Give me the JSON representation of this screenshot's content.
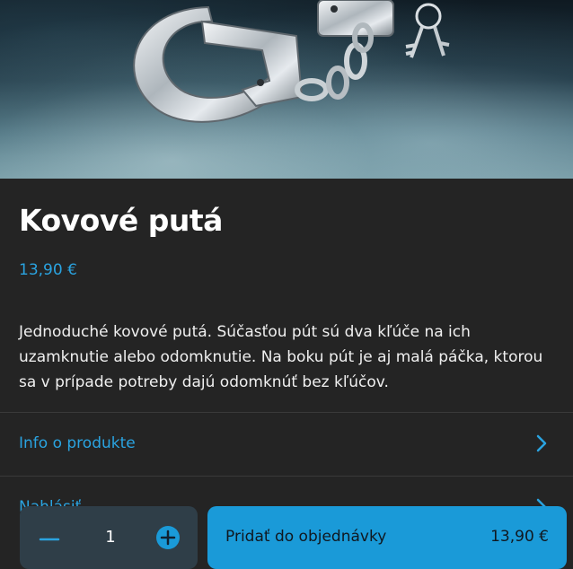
{
  "product": {
    "image_alt": "Kovové putá s kľúčmi",
    "title": "Kovové putá",
    "price": "13,90 €",
    "description": "Jednoduché kovové putá. Súčasťou pút sú dva kľúče na ich uzamknutie alebo odomknutie. Na boku pút je aj malá páčka, ktorou sa v prípade potreby dajú odomknúť bez kľúčov."
  },
  "sections": [
    {
      "label": "Info o produkte",
      "icon": "chevron-right-icon"
    },
    {
      "label": "Nahlásiť",
      "icon": "chevron-right-icon"
    }
  ],
  "cart_bar": {
    "quantity": "1",
    "add_label": "Pridať do objednávky",
    "total": "13,90 €"
  },
  "colors": {
    "background": "#242424",
    "accent": "#1a9ad8",
    "link": "#2aa3e0",
    "quantity_bg": "#2f3e48"
  }
}
